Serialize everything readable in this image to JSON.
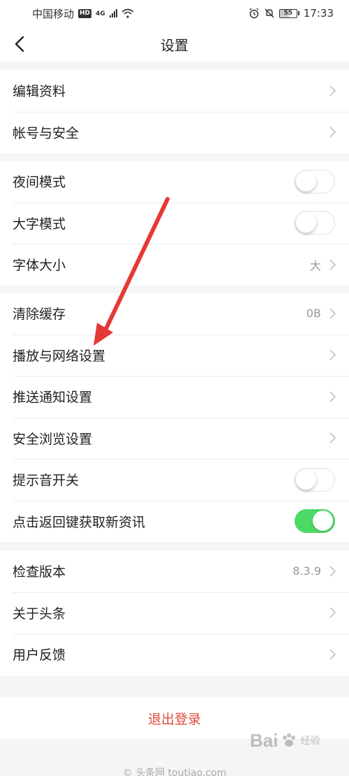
{
  "status_bar": {
    "carrier": "中国移动",
    "hd_badge": "HD",
    "network": "4G",
    "battery": "55",
    "time": "17:33"
  },
  "nav": {
    "title": "设置"
  },
  "groups": [
    {
      "items": [
        {
          "label": "编辑资料",
          "value": "",
          "control": "chevron"
        },
        {
          "label": "帐号与安全",
          "value": "",
          "control": "chevron"
        }
      ]
    },
    {
      "items": [
        {
          "label": "夜间模式",
          "control": "toggle",
          "on": false
        },
        {
          "label": "大字模式",
          "control": "toggle",
          "on": false
        },
        {
          "label": "字体大小",
          "value": "大",
          "control": "chevron"
        }
      ]
    },
    {
      "items": [
        {
          "label": "清除缓存",
          "value": "0B",
          "control": "chevron"
        },
        {
          "label": "播放与网络设置",
          "value": "",
          "control": "chevron"
        },
        {
          "label": "推送通知设置",
          "value": "",
          "control": "chevron"
        },
        {
          "label": "安全浏览设置",
          "value": "",
          "control": "chevron"
        },
        {
          "label": "提示音开关",
          "control": "toggle",
          "on": false
        },
        {
          "label": "点击返回键获取新资讯",
          "control": "toggle",
          "on": true
        }
      ]
    },
    {
      "items": [
        {
          "label": "检查版本",
          "value": "8.3.9",
          "control": "chevron"
        },
        {
          "label": "关于头条",
          "value": "",
          "control": "chevron"
        },
        {
          "label": "用户反馈",
          "value": "",
          "control": "chevron"
        }
      ]
    }
  ],
  "logout_label": "退出登录",
  "footer_text": "© 头条网 toutiao.com",
  "watermark": {
    "text": "Bai",
    "sub": "经验"
  },
  "colors": {
    "accent_red": "#e0483b",
    "toggle_on": "#4cd964",
    "annotation_arrow": "#e53935"
  }
}
